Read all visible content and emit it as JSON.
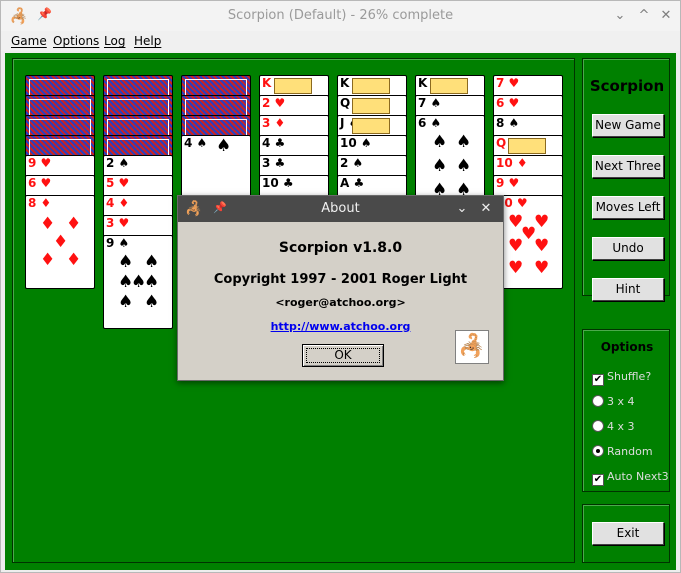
{
  "window": {
    "title": "Scorpion (Default) - 26% complete",
    "minimize": "⌄",
    "maximize": "^",
    "close": "✕"
  },
  "menu": [
    "Game",
    "Options",
    "Log",
    "Help"
  ],
  "panel": {
    "game_title": "Scorpion",
    "buttons": [
      "New Game",
      "Next Three",
      "Moves Left",
      "Undo",
      "Hint"
    ],
    "options_title": "Options",
    "options": [
      {
        "type": "checkbox",
        "label": "Shuffle?",
        "checked": true
      },
      {
        "type": "radio",
        "label": "3 x 4",
        "checked": false
      },
      {
        "type": "radio",
        "label": "4 x 3",
        "checked": false
      },
      {
        "type": "radio",
        "label": "Random",
        "checked": true
      },
      {
        "type": "checkbox",
        "label": "Auto Next3",
        "checked": true
      }
    ],
    "exit": "Exit"
  },
  "dialog": {
    "title": "About",
    "name": "Scorpion v1.8.0",
    "copyright": "Copyright 1997 - 2001 Roger Light",
    "email": "<roger@atchoo.org>",
    "url": "http://www.atchoo.org",
    "ok": "OK",
    "minimize": "⌄",
    "close": "✕"
  },
  "cards": {
    "col1": [
      "9 ♥",
      "6 ♥",
      "8 ♦"
    ],
    "col2": [
      "2 ♠",
      "5 ♥",
      "4 ♦",
      "3 ♥",
      "9 ♠"
    ],
    "col3": [
      "4 ♠"
    ],
    "col4": [
      "K ♦",
      "2 ♥",
      "3 ♦",
      "4 ♣",
      "3 ♣",
      "10 ♣"
    ],
    "col5": [
      "K ♠",
      "Q ♠",
      "J ♠",
      "10 ♠",
      "2 ♠",
      "A ♣"
    ],
    "col6": [
      "K ♠",
      "7 ♠",
      "6 ♠"
    ],
    "col7": [
      "7 ♥",
      "6 ♥",
      "8 ♠",
      "Q ♥",
      "10 ♦",
      "9 ♥",
      "10 ♥"
    ]
  },
  "colors": {
    "felt": "#008000",
    "red_suit": "#ff1111",
    "card_back": "#2a3fbf"
  }
}
